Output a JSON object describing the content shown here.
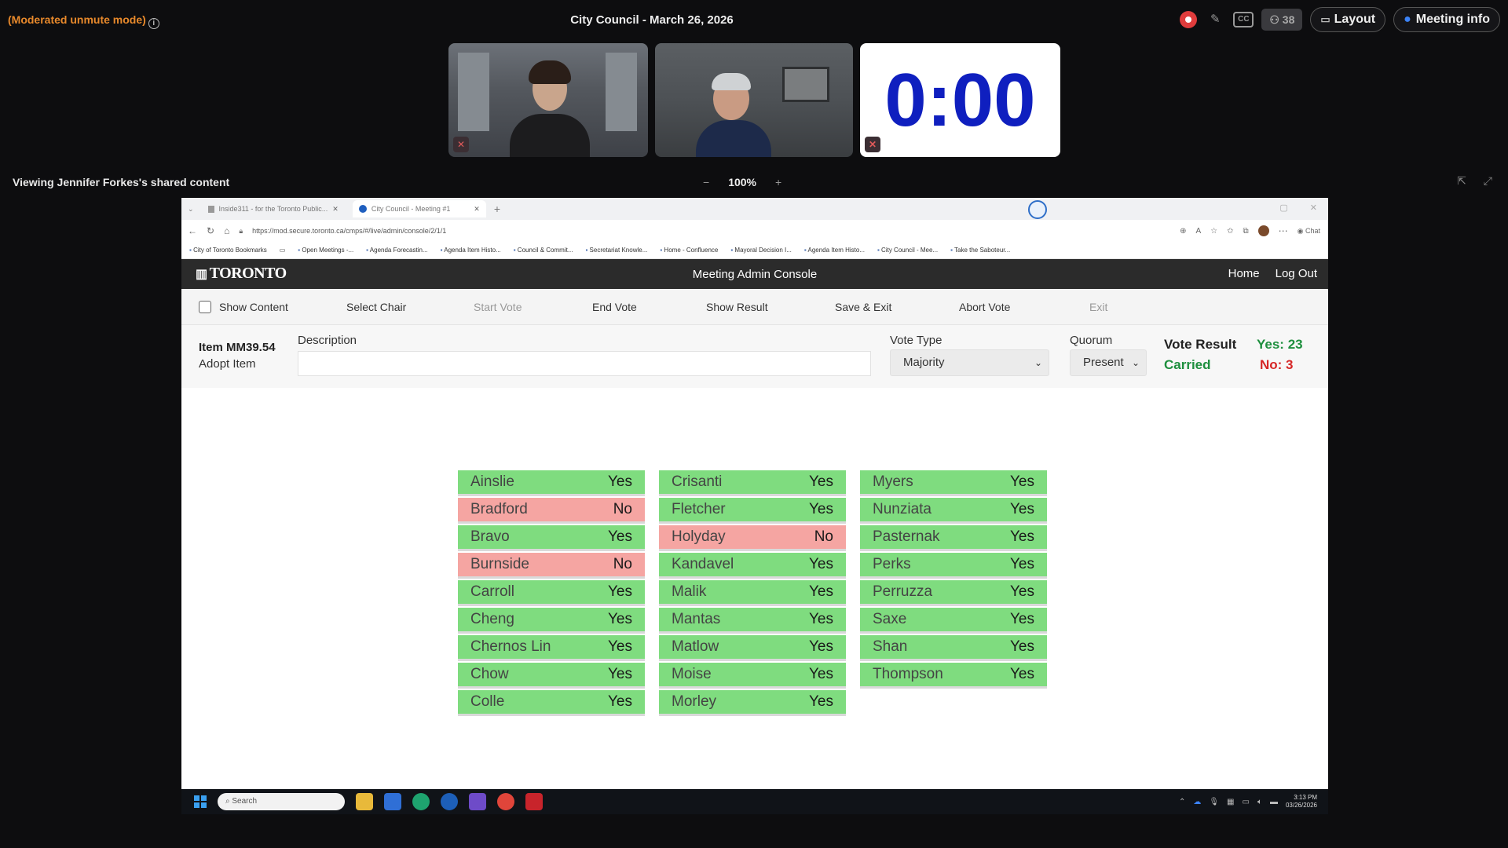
{
  "meeting": {
    "mode": "(Moderated unmute mode)",
    "title": "City Council - March 26, 2026",
    "participants": "38",
    "layout_label": "Layout",
    "info_label": "Meeting info",
    "timer": "0:00",
    "viewing": "Viewing Jennifer Forkes's shared content",
    "zoom": "100%"
  },
  "browser": {
    "tabs": [
      {
        "label": "Inside311 - for the Toronto Public..."
      },
      {
        "label": "City Council - Meeting #1"
      }
    ],
    "url": "https://mod.secure.toronto.ca/cmps/#/live/admin/console/2/1/1",
    "copilot_label": "Chat",
    "bookmarks": [
      "City of Toronto Bookmarks",
      "Open Meetings -...",
      "Agenda Forecastin...",
      "Agenda Item Histo...",
      "Council & Commit...",
      "Secretariat Knowle...",
      "Home - Confluence",
      "Mayoral Decision I...",
      "Agenda Item Histo...",
      "City Council - Mee...",
      "Take the Saboteur..."
    ]
  },
  "app": {
    "logo": "TORONTO",
    "title": "Meeting Admin Console",
    "home": "Home",
    "logout": "Log Out",
    "toolbar": {
      "show_content": "Show Content",
      "select_chair": "Select Chair",
      "start_vote": "Start Vote",
      "end_vote": "End Vote",
      "show_result": "Show Result",
      "save_exit": "Save & Exit",
      "abort_vote": "Abort Vote",
      "exit": "Exit"
    },
    "item": {
      "id": "Item MM39.54",
      "action": "Adopt Item",
      "description_label": "Description",
      "description_value": "",
      "vote_type_label": "Vote Type",
      "vote_type": "Majority",
      "quorum_label": "Quorum",
      "quorum": "Present",
      "vote_result_label": "Vote Result",
      "status": "Carried",
      "yes": "Yes: 23",
      "no": "No: 3"
    },
    "votes": [
      [
        {
          "name": "Ainslie",
          "vote": "Yes"
        },
        {
          "name": "Bradford",
          "vote": "No"
        },
        {
          "name": "Bravo",
          "vote": "Yes"
        },
        {
          "name": "Burnside",
          "vote": "No"
        },
        {
          "name": "Carroll",
          "vote": "Yes"
        },
        {
          "name": "Cheng",
          "vote": "Yes"
        },
        {
          "name": "Chernos Lin",
          "vote": "Yes"
        },
        {
          "name": "Chow",
          "vote": "Yes"
        },
        {
          "name": "Colle",
          "vote": "Yes"
        }
      ],
      [
        {
          "name": "Crisanti",
          "vote": "Yes"
        },
        {
          "name": "Fletcher",
          "vote": "Yes"
        },
        {
          "name": "Holyday",
          "vote": "No"
        },
        {
          "name": "Kandavel",
          "vote": "Yes"
        },
        {
          "name": "Malik",
          "vote": "Yes"
        },
        {
          "name": "Mantas",
          "vote": "Yes"
        },
        {
          "name": "Matlow",
          "vote": "Yes"
        },
        {
          "name": "Moise",
          "vote": "Yes"
        },
        {
          "name": "Morley",
          "vote": "Yes"
        }
      ],
      [
        {
          "name": "Myers",
          "vote": "Yes"
        },
        {
          "name": "Nunziata",
          "vote": "Yes"
        },
        {
          "name": "Pasternak",
          "vote": "Yes"
        },
        {
          "name": "Perks",
          "vote": "Yes"
        },
        {
          "name": "Perruzza",
          "vote": "Yes"
        },
        {
          "name": "Saxe",
          "vote": "Yes"
        },
        {
          "name": "Shan",
          "vote": "Yes"
        },
        {
          "name": "Thompson",
          "vote": "Yes"
        }
      ]
    ]
  },
  "taskbar": {
    "search": "Search",
    "time": "3:13 PM",
    "date": "03/26/2026"
  },
  "colors": {
    "yes_bg": "#7fdc7f",
    "no_bg": "#f5a5a2",
    "carried": "#1e8f3e",
    "no_text": "#d62626",
    "timer": "#0f1fbf",
    "mode": "#e8892b"
  }
}
